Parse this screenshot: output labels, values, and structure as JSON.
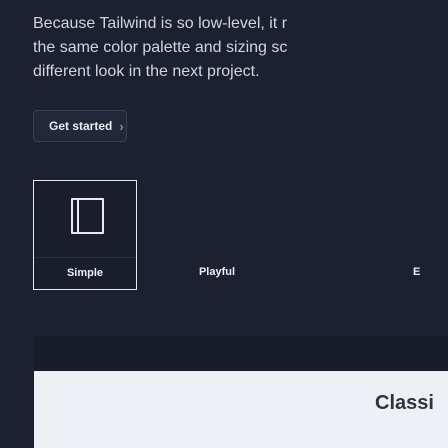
{
  "intro": {
    "lines": [
      "Because Tailwind is so low-level, it r",
      "the same color palette and sizing sc",
      "different look in the next project."
    ]
  },
  "actions": {
    "get_started_label": "Get started",
    "get_started_icon": "chevron-right-icon"
  },
  "styles": {
    "simple_label": "Simple",
    "playful_label": "Playful",
    "elegant_label": "E",
    "simple_icon": "book-icon"
  },
  "preview": {
    "title": "Classi"
  }
}
